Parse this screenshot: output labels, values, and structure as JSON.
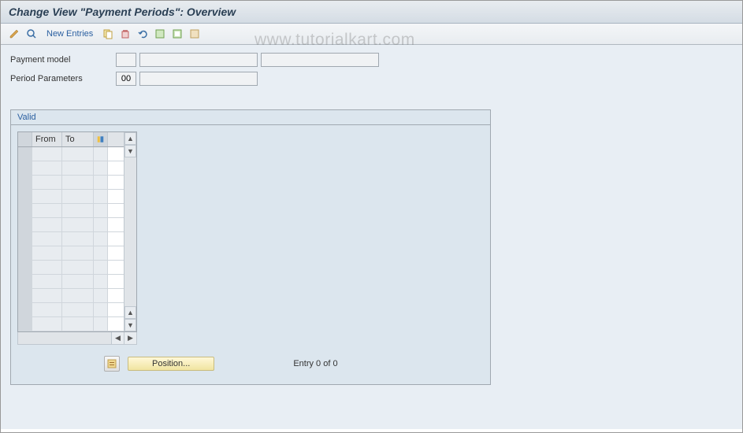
{
  "title": "Change View \"Payment Periods\": Overview",
  "toolbar": {
    "new_entries": "New Entries"
  },
  "form": {
    "payment_model_label": "Payment model",
    "payment_model_code": "",
    "payment_model_text": "",
    "payment_model_extra": "",
    "period_params_label": "Period Parameters",
    "period_params_code": "00",
    "period_params_text": ""
  },
  "panel": {
    "title": "Valid",
    "col_from": "From",
    "col_to": "To",
    "rows": [
      "",
      "",
      "",
      "",
      "",
      "",
      "",
      "",
      "",
      "",
      "",
      "",
      ""
    ],
    "position_label": "Position...",
    "entry_text": "Entry 0 of 0"
  },
  "watermark": "www.tutorialkart.com"
}
